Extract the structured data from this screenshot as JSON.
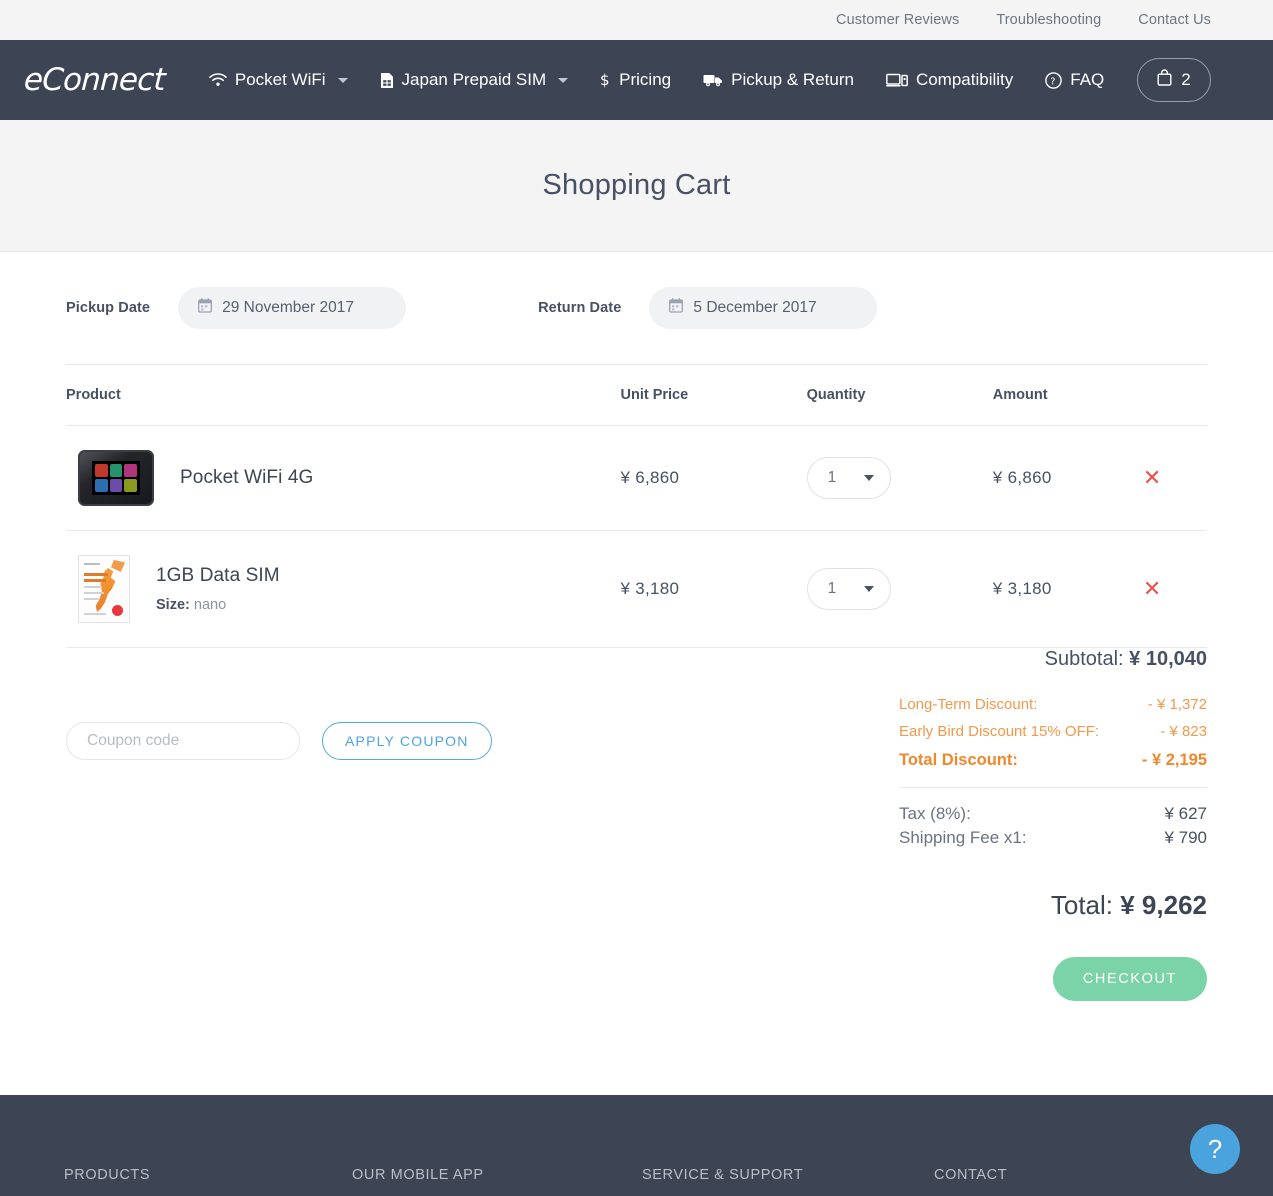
{
  "topbar": {
    "links": [
      {
        "label": "Customer Reviews"
      },
      {
        "label": "Troubleshooting"
      },
      {
        "label": "Contact Us"
      }
    ]
  },
  "navbar": {
    "logo": "eConnect",
    "items": [
      {
        "label": "Pocket WiFi",
        "icon": "wifi-icon",
        "has_caret": true
      },
      {
        "label": "Japan Prepaid SIM",
        "icon": "sim-card-icon",
        "has_caret": true
      },
      {
        "label": "Pricing",
        "icon": "dollar-icon",
        "has_caret": false
      },
      {
        "label": "Pickup & Return",
        "icon": "truck-icon",
        "has_caret": false
      },
      {
        "label": "Compatibility",
        "icon": "devices-icon",
        "has_caret": false
      },
      {
        "label": "FAQ",
        "icon": "question-circle-icon",
        "has_caret": false
      }
    ],
    "cart": {
      "icon": "shopping-bag-icon",
      "count": "2"
    }
  },
  "hero": {
    "title": "Shopping Cart"
  },
  "dates": {
    "pickup_label": "Pickup Date",
    "pickup_value": "29 November 2017",
    "return_label": "Return Date",
    "return_value": "5 December 2017",
    "calendar_icon": "calendar-icon"
  },
  "table": {
    "headers": {
      "product": "Product",
      "unit_price": "Unit Price",
      "quantity": "Quantity",
      "amount": "Amount"
    },
    "rows": [
      {
        "name": "Pocket WiFi 4G",
        "attr_label": "",
        "attr_value": "",
        "unit_price": "¥ 6,860",
        "quantity": "1",
        "amount": "¥ 6,860",
        "remove_icon": "close-x-icon",
        "thumb": "pocket-wifi-device-thumbnail"
      },
      {
        "name": "1GB Data SIM",
        "attr_label": "Size:",
        "attr_value": "nano",
        "unit_price": "¥ 3,180",
        "quantity": "1",
        "amount": "¥ 3,180",
        "remove_icon": "close-x-icon",
        "thumb": "japan-prepaid-sim-package-thumbnail"
      }
    ]
  },
  "coupon": {
    "placeholder": "Coupon code",
    "value": "",
    "apply_label": "APPLY COUPON"
  },
  "summary": {
    "subtotal_label": "Subtotal:",
    "subtotal_value": "¥ 10,040",
    "discounts": [
      {
        "label": "Long-Term Discount:",
        "value": "- ¥ 1,372"
      },
      {
        "label": "Early Bird Discount 15% OFF:",
        "value": "- ¥ 823"
      }
    ],
    "total_discount_label": "Total Discount:",
    "total_discount_value": "- ¥ 2,195",
    "fees": [
      {
        "label": "Tax (8%):",
        "value": "¥ 627"
      },
      {
        "label": "Shipping Fee x1:",
        "value": "¥ 790"
      }
    ],
    "total_label": "Total:",
    "total_value": "¥ 9,262",
    "checkout_label": "CHECKOUT"
  },
  "footer": {
    "columns": [
      {
        "label": "PRODUCTS"
      },
      {
        "label": "OUR MOBILE APP"
      },
      {
        "label": "SERVICE & SUPPORT"
      },
      {
        "label": "CONTACT"
      }
    ],
    "help_icon": "question-mark-icon",
    "help_label": "?"
  },
  "colors": {
    "navy": "#3d4454",
    "accent_orange": "#f2994a",
    "accent_green": "#7bd4a8",
    "accent_blue": "#4fa3e3",
    "remove_red": "#e8534e"
  }
}
